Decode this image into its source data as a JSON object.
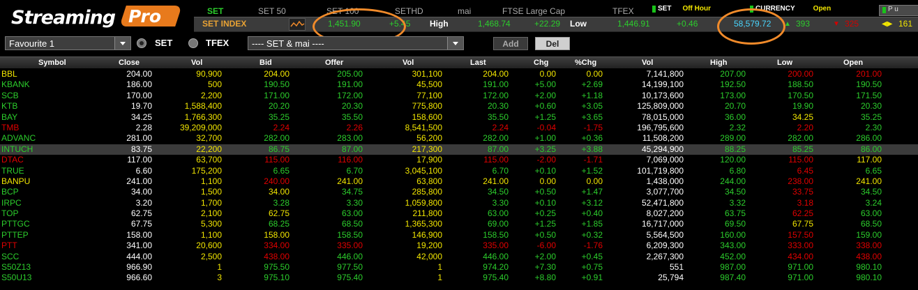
{
  "logo": {
    "text": "Streaming",
    "pro": "Pro"
  },
  "market_tabs": [
    "SET",
    "SET 50",
    "SET 100",
    "SETHD",
    "mai",
    "FTSE Large Cap",
    "TFEX"
  ],
  "status": {
    "set_label": "SET",
    "set_value": "Off Hour",
    "currency_label": "CURRENCY",
    "currency_value": "Open",
    "p_button": "P u"
  },
  "index": {
    "name": "SET INDEX",
    "value": "1,451.90",
    "change": "+5.45",
    "high_label": "High",
    "high": "1,468.74",
    "high_change": "+22.29",
    "low_label": "Low",
    "low": "1,446.91",
    "low_change": "+0.46",
    "value_traded": "58,579.72",
    "advances": "393",
    "declines": "325",
    "unchanged": "161"
  },
  "controls": {
    "favourite": "Favourite 1",
    "radio_set": "SET",
    "radio_tfex": "TFEX",
    "market_select": "---- SET & mai ----",
    "add": "Add",
    "del": "Del"
  },
  "columns": [
    "Symbol",
    "Close",
    "Vol",
    "Bid",
    "Offer",
    "Vol",
    "Last",
    "Chg",
    "%Chg",
    "Vol",
    "High",
    "Low",
    "Open"
  ],
  "rows": [
    {
      "symbol": "BBL",
      "close": "204.00",
      "bidvol": "90,900",
      "bid": "204.00",
      "offer": "205.00",
      "offervol": "301,100",
      "last": "204.00",
      "chg": "0.00",
      "pchg": "0.00",
      "vol": "7,141,800",
      "high": "207.00",
      "low": "200.00",
      "open": "201.00",
      "c": {
        "sym": "un",
        "bidvol": "un",
        "bid": "un",
        "offer": "up",
        "offervol": "un",
        "last": "un",
        "chg": "un",
        "high": "up",
        "low": "dn",
        "open": "dn"
      }
    },
    {
      "symbol": "KBANK",
      "close": "186.00",
      "bidvol": "500",
      "bid": "190.50",
      "offer": "191.00",
      "offervol": "45,500",
      "last": "191.00",
      "chg": "+5.00",
      "pchg": "+2.69",
      "vol": "14,199,100",
      "high": "192.50",
      "low": "188.50",
      "open": "190.50",
      "c": {
        "sym": "up",
        "bidvol": "un",
        "bid": "up",
        "offer": "up",
        "offervol": "un",
        "last": "up",
        "chg": "up",
        "high": "up",
        "low": "up",
        "open": "up"
      }
    },
    {
      "symbol": "SCB",
      "close": "170.00",
      "bidvol": "2,200",
      "bid": "171.00",
      "offer": "172.00",
      "offervol": "77,100",
      "last": "172.00",
      "chg": "+2.00",
      "pchg": "+1.18",
      "vol": "10,173,600",
      "high": "173.00",
      "low": "170.50",
      "open": "171.50",
      "c": {
        "sym": "up",
        "bidvol": "un",
        "bid": "up",
        "offer": "up",
        "offervol": "un",
        "last": "up",
        "chg": "up",
        "high": "up",
        "low": "up",
        "open": "up"
      }
    },
    {
      "symbol": "KTB",
      "close": "19.70",
      "bidvol": "1,588,400",
      "bid": "20.20",
      "offer": "20.30",
      "offervol": "775,800",
      "last": "20.30",
      "chg": "+0.60",
      "pchg": "+3.05",
      "vol": "125,809,000",
      "high": "20.70",
      "low": "19.90",
      "open": "20.30",
      "c": {
        "sym": "up",
        "bidvol": "un",
        "bid": "up",
        "offer": "up",
        "offervol": "un",
        "last": "up",
        "chg": "up",
        "high": "up",
        "low": "up",
        "open": "up"
      }
    },
    {
      "symbol": "BAY",
      "close": "34.25",
      "bidvol": "1,766,300",
      "bid": "35.25",
      "offer": "35.50",
      "offervol": "158,600",
      "last": "35.50",
      "chg": "+1.25",
      "pchg": "+3.65",
      "vol": "78,015,000",
      "high": "36.00",
      "low": "34.25",
      "open": "35.25",
      "c": {
        "sym": "up",
        "bidvol": "un",
        "bid": "up",
        "offer": "up",
        "offervol": "un",
        "last": "up",
        "chg": "up",
        "high": "up",
        "low": "un",
        "open": "up"
      }
    },
    {
      "symbol": "TMB",
      "close": "2.28",
      "bidvol": "39,209,000",
      "bid": "2.24",
      "offer": "2.26",
      "offervol": "8,541,500",
      "last": "2.24",
      "chg": "-0.04",
      "pchg": "-1.75",
      "vol": "196,795,600",
      "high": "2.32",
      "low": "2.20",
      "open": "2.30",
      "c": {
        "sym": "dn",
        "bidvol": "un",
        "bid": "dn",
        "offer": "dn",
        "offervol": "un",
        "last": "dn",
        "chg": "dn",
        "high": "up",
        "low": "dn",
        "open": "up"
      }
    },
    {
      "symbol": "ADVANC",
      "close": "281.00",
      "bidvol": "32,700",
      "bid": "282.00",
      "offer": "283.00",
      "offervol": "56,200",
      "last": "282.00",
      "chg": "+1.00",
      "pchg": "+0.36",
      "vol": "11,508,200",
      "high": "289.00",
      "low": "282.00",
      "open": "286.00",
      "c": {
        "sym": "up",
        "bidvol": "un",
        "bid": "up",
        "offer": "up",
        "offervol": "un",
        "last": "up",
        "chg": "up",
        "high": "up",
        "low": "up",
        "open": "up"
      }
    },
    {
      "symbol": "INTUCH",
      "close": "83.75",
      "bidvol": "22,200",
      "bid": "86.75",
      "offer": "87.00",
      "offervol": "217,300",
      "last": "87.00",
      "chg": "+3.25",
      "pchg": "+3.88",
      "vol": "45,294,900",
      "high": "88.25",
      "low": "85.25",
      "open": "86.00",
      "sel": true,
      "c": {
        "sym": "up",
        "bidvol": "un",
        "bid": "up",
        "offer": "up",
        "offervol": "un",
        "last": "up",
        "chg": "up",
        "high": "up",
        "low": "up",
        "open": "up"
      }
    },
    {
      "symbol": "DTAC",
      "close": "117.00",
      "bidvol": "63,700",
      "bid": "115.00",
      "offer": "116.00",
      "offervol": "17,900",
      "last": "115.00",
      "chg": "-2.00",
      "pchg": "-1.71",
      "vol": "7,069,000",
      "high": "120.00",
      "low": "115.00",
      "open": "117.00",
      "c": {
        "sym": "dn",
        "bidvol": "un",
        "bid": "dn",
        "offer": "dn",
        "offervol": "un",
        "last": "dn",
        "chg": "dn",
        "high": "up",
        "low": "dn",
        "open": "un"
      }
    },
    {
      "symbol": "TRUE",
      "close": "6.60",
      "bidvol": "175,200",
      "bid": "6.65",
      "offer": "6.70",
      "offervol": "3,045,100",
      "last": "6.70",
      "chg": "+0.10",
      "pchg": "+1.52",
      "vol": "101,719,800",
      "high": "6.80",
      "low": "6.45",
      "open": "6.65",
      "c": {
        "sym": "up",
        "bidvol": "un",
        "bid": "up",
        "offer": "up",
        "offervol": "un",
        "last": "up",
        "chg": "up",
        "high": "up",
        "low": "dn",
        "open": "up"
      }
    },
    {
      "symbol": "BANPU",
      "close": "241.00",
      "bidvol": "1,100",
      "bid": "240.00",
      "offer": "241.00",
      "offervol": "63,800",
      "last": "241.00",
      "chg": "0.00",
      "pchg": "0.00",
      "vol": "1,438,000",
      "high": "244.00",
      "low": "238.00",
      "open": "241.00",
      "c": {
        "sym": "un",
        "bidvol": "un",
        "bid": "dn",
        "offer": "un",
        "offervol": "un",
        "last": "un",
        "chg": "un",
        "high": "up",
        "low": "dn",
        "open": "un"
      }
    },
    {
      "symbol": "BCP",
      "close": "34.00",
      "bidvol": "1,500",
      "bid": "34.00",
      "offer": "34.75",
      "offervol": "285,800",
      "last": "34.50",
      "chg": "+0.50",
      "pchg": "+1.47",
      "vol": "3,077,700",
      "high": "34.50",
      "low": "33.75",
      "open": "34.50",
      "c": {
        "sym": "up",
        "bidvol": "un",
        "bid": "un",
        "offer": "up",
        "offervol": "un",
        "last": "up",
        "chg": "up",
        "high": "up",
        "low": "dn",
        "open": "up"
      }
    },
    {
      "symbol": "IRPC",
      "close": "3.20",
      "bidvol": "1,700",
      "bid": "3.28",
      "offer": "3.30",
      "offervol": "1,059,800",
      "last": "3.30",
      "chg": "+0.10",
      "pchg": "+3.12",
      "vol": "52,471,800",
      "high": "3.32",
      "low": "3.18",
      "open": "3.24",
      "c": {
        "sym": "up",
        "bidvol": "un",
        "bid": "up",
        "offer": "up",
        "offervol": "un",
        "last": "up",
        "chg": "up",
        "high": "up",
        "low": "dn",
        "open": "up"
      }
    },
    {
      "symbol": "TOP",
      "close": "62.75",
      "bidvol": "2,100",
      "bid": "62.75",
      "offer": "63.00",
      "offervol": "211,800",
      "last": "63.00",
      "chg": "+0.25",
      "pchg": "+0.40",
      "vol": "8,027,200",
      "high": "63.75",
      "low": "62.25",
      "open": "63.00",
      "c": {
        "sym": "up",
        "bidvol": "un",
        "bid": "un",
        "offer": "up",
        "offervol": "un",
        "last": "up",
        "chg": "up",
        "high": "up",
        "low": "dn",
        "open": "up"
      }
    },
    {
      "symbol": "PTTGC",
      "close": "67.75",
      "bidvol": "5,300",
      "bid": "68.25",
      "offer": "68.50",
      "offervol": "1,365,300",
      "last": "69.00",
      "chg": "+1.25",
      "pchg": "+1.85",
      "vol": "16,717,000",
      "high": "69.50",
      "low": "67.75",
      "open": "68.50",
      "c": {
        "sym": "up",
        "bidvol": "un",
        "bid": "up",
        "offer": "up",
        "offervol": "un",
        "last": "up",
        "chg": "up",
        "high": "up",
        "low": "un",
        "open": "up"
      }
    },
    {
      "symbol": "PTTEP",
      "close": "158.00",
      "bidvol": "1,100",
      "bid": "158.00",
      "offer": "158.50",
      "offervol": "146,900",
      "last": "158.50",
      "chg": "+0.50",
      "pchg": "+0.32",
      "vol": "5,564,500",
      "high": "160.00",
      "low": "157.50",
      "open": "159.00",
      "c": {
        "sym": "up",
        "bidvol": "un",
        "bid": "un",
        "offer": "up",
        "offervol": "un",
        "last": "up",
        "chg": "up",
        "high": "up",
        "low": "dn",
        "open": "up"
      }
    },
    {
      "symbol": "PTT",
      "close": "341.00",
      "bidvol": "20,600",
      "bid": "334.00",
      "offer": "335.00",
      "offervol": "19,200",
      "last": "335.00",
      "chg": "-6.00",
      "pchg": "-1.76",
      "vol": "6,209,300",
      "high": "343.00",
      "low": "333.00",
      "open": "338.00",
      "c": {
        "sym": "dn",
        "bidvol": "un",
        "bid": "dn",
        "offer": "dn",
        "offervol": "un",
        "last": "dn",
        "chg": "dn",
        "high": "up",
        "low": "dn",
        "open": "dn"
      }
    },
    {
      "symbol": "SCC",
      "close": "444.00",
      "bidvol": "2,500",
      "bid": "438.00",
      "offer": "446.00",
      "offervol": "42,000",
      "last": "446.00",
      "chg": "+2.00",
      "pchg": "+0.45",
      "vol": "2,267,300",
      "high": "452.00",
      "low": "434.00",
      "open": "438.00",
      "c": {
        "sym": "up",
        "bidvol": "un",
        "bid": "dn",
        "offer": "up",
        "offervol": "un",
        "last": "up",
        "chg": "up",
        "high": "up",
        "low": "dn",
        "open": "dn"
      }
    },
    {
      "symbol": "S50Z13",
      "close": "966.90",
      "bidvol": "1",
      "bid": "975.50",
      "offer": "977.50",
      "offervol": "1",
      "last": "974.20",
      "chg": "+7.30",
      "pchg": "+0.75",
      "vol": "551",
      "high": "987.00",
      "low": "971.00",
      "open": "980.10",
      "c": {
        "sym": "up",
        "bidvol": "un",
        "bid": "up",
        "offer": "up",
        "offervol": "un",
        "last": "up",
        "chg": "up",
        "high": "up",
        "low": "up",
        "open": "up"
      }
    },
    {
      "symbol": "S50U13",
      "close": "966.60",
      "bidvol": "3",
      "bid": "975.10",
      "offer": "975.40",
      "offervol": "1",
      "last": "975.40",
      "chg": "+8.80",
      "pchg": "+0.91",
      "vol": "25,794",
      "high": "987.40",
      "low": "971.00",
      "open": "980.10",
      "c": {
        "sym": "up",
        "bidvol": "un",
        "bid": "up",
        "offer": "up",
        "offervol": "un",
        "last": "up",
        "chg": "up",
        "high": "up",
        "low": "up",
        "open": "up"
      }
    }
  ],
  "colors": {
    "up": "#2ccd2c",
    "down": "#e10000",
    "unchanged": "#f2e600",
    "accent": "#f08a2a"
  }
}
